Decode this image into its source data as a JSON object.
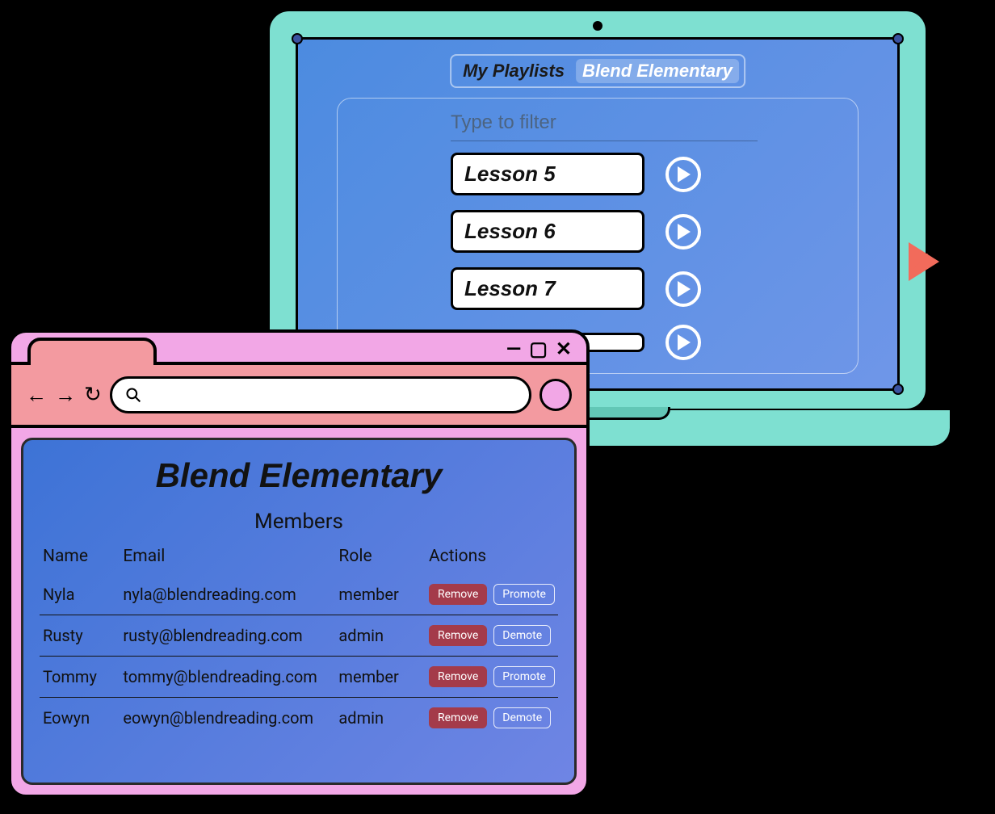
{
  "laptop": {
    "tabs": {
      "inactive": "My Playlists",
      "active": "Blend Elementary"
    },
    "filter_placeholder": "Type to filter",
    "lessons": [
      "Lesson 5",
      "Lesson 6",
      "Lesson 7"
    ]
  },
  "browser": {
    "window_controls": {
      "minimize": "—",
      "maximize": "▢",
      "close": "✕"
    },
    "nav": {
      "back": "←",
      "forward": "→",
      "reload": "↻"
    },
    "page_title": "Blend Elementary",
    "section_title": "Members",
    "columns": {
      "name": "Name",
      "email": "Email",
      "role": "Role",
      "actions": "Actions"
    },
    "action_labels": {
      "remove": "Remove",
      "promote": "Promote",
      "demote": "Demote"
    },
    "members": [
      {
        "name": "Nyla",
        "email": "nyla@blendreading.com",
        "role": "member",
        "secondary_action": "promote"
      },
      {
        "name": "Rusty",
        "email": "rusty@blendreading.com",
        "role": "admin",
        "secondary_action": "demote"
      },
      {
        "name": "Tommy",
        "email": "tommy@blendreading.com",
        "role": "member",
        "secondary_action": "promote"
      },
      {
        "name": "Eowyn",
        "email": "eowyn@blendreading.com",
        "role": "admin",
        "secondary_action": "demote"
      }
    ]
  }
}
